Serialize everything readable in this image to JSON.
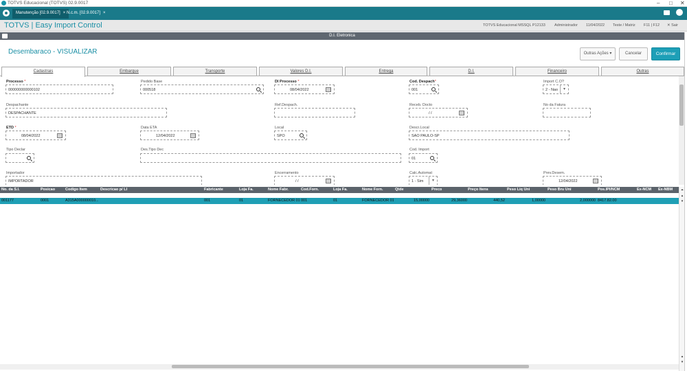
{
  "window": {
    "title": "TOTVS Educacional (TOTVS) 02.9.0017"
  },
  "app_tabs": [
    {
      "label": "Manutenção [02.9.0017]",
      "close": "×"
    },
    {
      "label": "N.c.m. [02.9.0017]",
      "close": "×"
    }
  ],
  "app": {
    "name": "TOTVS | Easy Import Control",
    "env": "TOTVS Educacional MSSQL P12133",
    "user": "Administrador",
    "date": "11/04/2022",
    "branch": "Teste / Matriz",
    "keys": "F11 | F12",
    "exit": "✕ Sair"
  },
  "dialog": {
    "title": "D.I. Eletronica"
  },
  "page": {
    "title": "Desembaraco - VISUALIZAR",
    "other_actions": "Outras Ações",
    "cancel": "Cancelar",
    "confirm": "Confirmar"
  },
  "tabs": [
    "Cadastrais",
    "Embarque",
    "Transporte",
    "Valores D.I.",
    "Entrega",
    "D.I.",
    "Financeiro",
    "Outras"
  ],
  "form": {
    "processo": {
      "label": "Processo",
      "value": "000000000000102"
    },
    "pedido_base": {
      "label": "Pedido Base",
      "value": "000518"
    },
    "di_processo": {
      "label": "DI Processo",
      "value": "08/04/2022"
    },
    "cod_despach": {
      "label": "Cod. Despach",
      "value": "001"
    },
    "import_co": {
      "label": "Import C.O?",
      "value": "2 - Nao"
    },
    "despachante": {
      "label": "Despachante",
      "value": "DESPACHANTE"
    },
    "ref_despach": {
      "label": "Ref.Despach.",
      "value": ""
    },
    "receb_docto": {
      "label": "Receb. Docto",
      "value": "/ /"
    },
    "no_fatura": {
      "label": "No da Fatura",
      "value": ""
    },
    "etd": {
      "label": "ETD",
      "value": "08/04/2022"
    },
    "data_eta": {
      "label": "Data ETA",
      "value": "12/04/2022"
    },
    "local": {
      "label": "Local",
      "value": "SPO"
    },
    "descr_local": {
      "label": "Descr.Local",
      "value": "SAO PAULO-SP"
    },
    "tipo_declar": {
      "label": "Tipo Declar",
      "value": ""
    },
    "des_tipo_dec": {
      "label": "Des.Tipo Dec",
      "value": ""
    },
    "cod_import": {
      "label": "Cod. Import",
      "value": "01"
    },
    "importador": {
      "label": "Importador",
      "value": "IMPORTADOR"
    },
    "encerramento": {
      "label": "Encerramento",
      "value": "/ /"
    },
    "calc_automat": {
      "label": "Calc.Automat",
      "value": "1 - Sim"
    },
    "prev_desem": {
      "label": "Prev.Desem.",
      "value": "12/04/2022"
    }
  },
  "grid": {
    "headers": [
      "No. da S.I.",
      "Posicao",
      "Codigo Item",
      "Descricao p/ LI",
      "Fabricante",
      "Loja Fa.",
      "Nome Fabr.",
      "Cod.Forn.",
      "Loja Fa.",
      "Nome Forn.",
      "Qtde",
      "Preco",
      "Preço Itens",
      "Peso Liq Uni",
      "Peso Bru Uni",
      "Pos.IPI/NCM",
      "Ex-NCM",
      "Ex-NBM"
    ],
    "rows": [
      [
        "001177",
        "0001",
        "A315A000000010...",
        "",
        "001",
        "01",
        "FORNECEDOR 01",
        "001",
        "01",
        "FORNECEDOR 01",
        "15,00000",
        "29,36000",
        "440,52",
        "1,00000",
        "2,000000",
        "8417.82.00",
        "",
        ""
      ]
    ]
  },
  "colors": {
    "accent": "#1d9fb7",
    "tabbar": "#1a7a8a",
    "grid_header": "#5b636b"
  }
}
